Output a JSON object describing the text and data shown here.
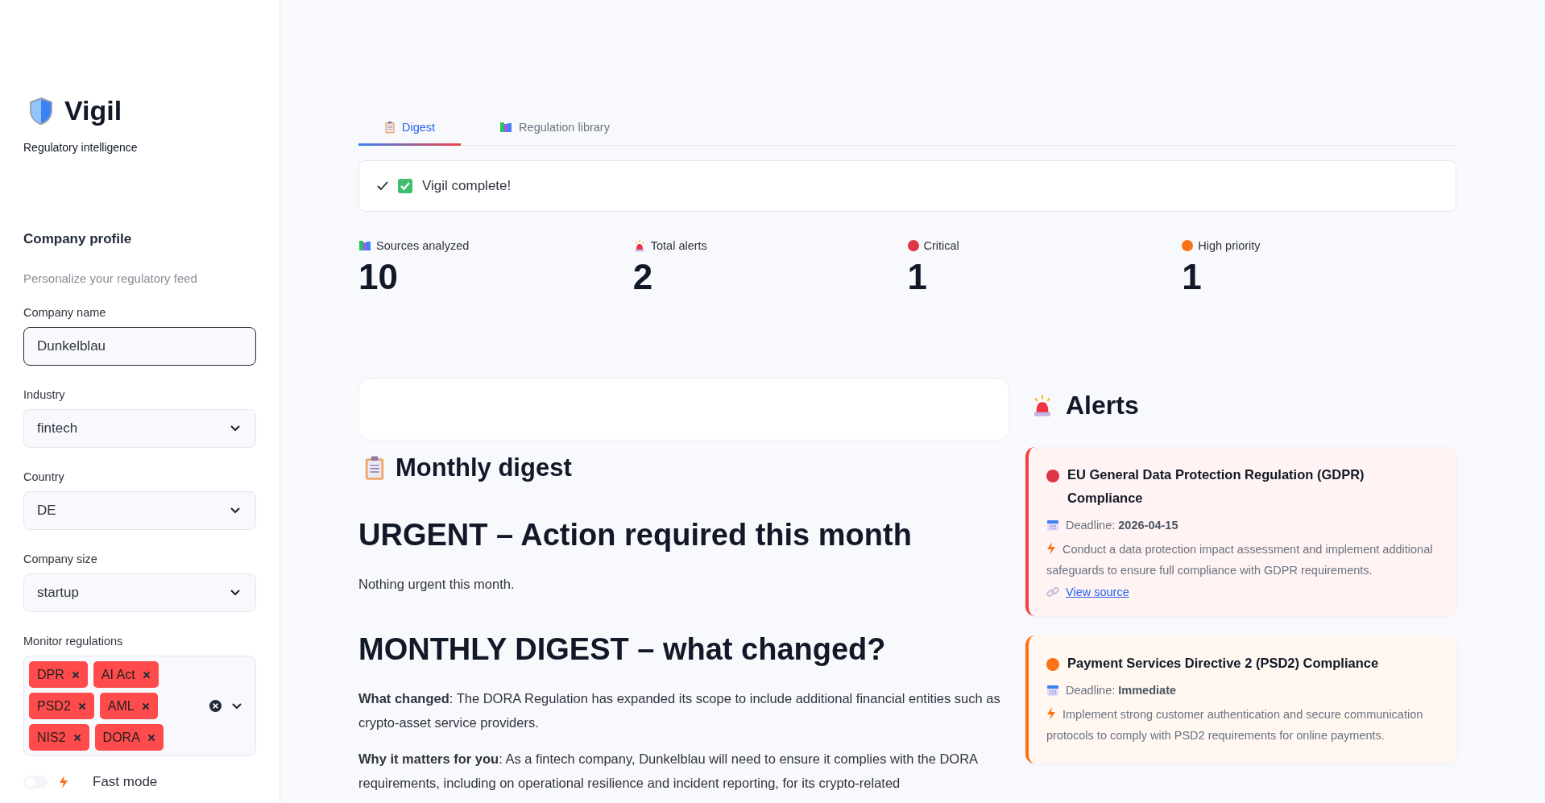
{
  "sidebar": {
    "app_name": "Vigil",
    "tagline": "Regulatory intelligence",
    "section_title": "Company profile",
    "section_caption": "Personalize your regulatory feed",
    "company_name": {
      "label": "Company name",
      "value": "Dunkelblau"
    },
    "selects": [
      {
        "label": "Industry",
        "value": "fintech"
      },
      {
        "label": "Country",
        "value": "DE"
      },
      {
        "label": "Company size",
        "value": "startup"
      }
    ],
    "monitor": {
      "label": "Monitor regulations",
      "tags": [
        "DPR",
        "AI Act",
        "PSD2",
        "AML",
        "NIS2",
        "DORA"
      ]
    },
    "fast_mode": {
      "label": "Fast mode",
      "on": false
    }
  },
  "tabs": [
    {
      "label": "Digest",
      "selected": true
    },
    {
      "label": "Regulation library",
      "selected": false
    }
  ],
  "status": {
    "message": "Vigil complete!"
  },
  "metrics": [
    {
      "label": "Sources analyzed",
      "value": "10"
    },
    {
      "label": "Total alerts",
      "value": "2"
    },
    {
      "label": "Critical",
      "value": "1"
    },
    {
      "label": "High priority",
      "value": "1"
    }
  ],
  "digest": {
    "title": "Monthly digest",
    "blocks": [
      {
        "kind": "heading",
        "text": "URGENT – Action required this month"
      },
      {
        "kind": "paragraph",
        "text": "Nothing urgent this month."
      },
      {
        "kind": "heading",
        "text": "MONTHLY DIGEST – what changed?"
      },
      {
        "kind": "paragraph",
        "text": "**What changed**: The DORA Regulation has expanded its scope to include additional financial entities such as crypto-asset service providers."
      },
      {
        "kind": "paragraph",
        "text": "**Why it matters for you**: As a fintech company, Dunkelblau will need to ensure it complies with the DORA requirements, including on operational resilience and incident reporting, for its crypto-related"
      }
    ]
  },
  "alerts": {
    "title": "Alerts",
    "items": [
      {
        "kind": "critical",
        "title": "EU General Data Protection Regulation (GDPR) Compliance",
        "deadline_label": "Deadline:",
        "deadline": "2026-04-15",
        "action": "Conduct a data protection impact assessment and implement additional safeguards to ensure full compliance with GDPR requirements.",
        "link": "View source"
      },
      {
        "kind": "high",
        "title": "Payment Services Directive 2 (PSD2) Compliance",
        "deadline_label": "Deadline:",
        "deadline": "Immediate",
        "action": "Implement strong customer authentication and secure communication protocols to comply with PSD2 requirements for online payments."
      }
    ]
  }
}
